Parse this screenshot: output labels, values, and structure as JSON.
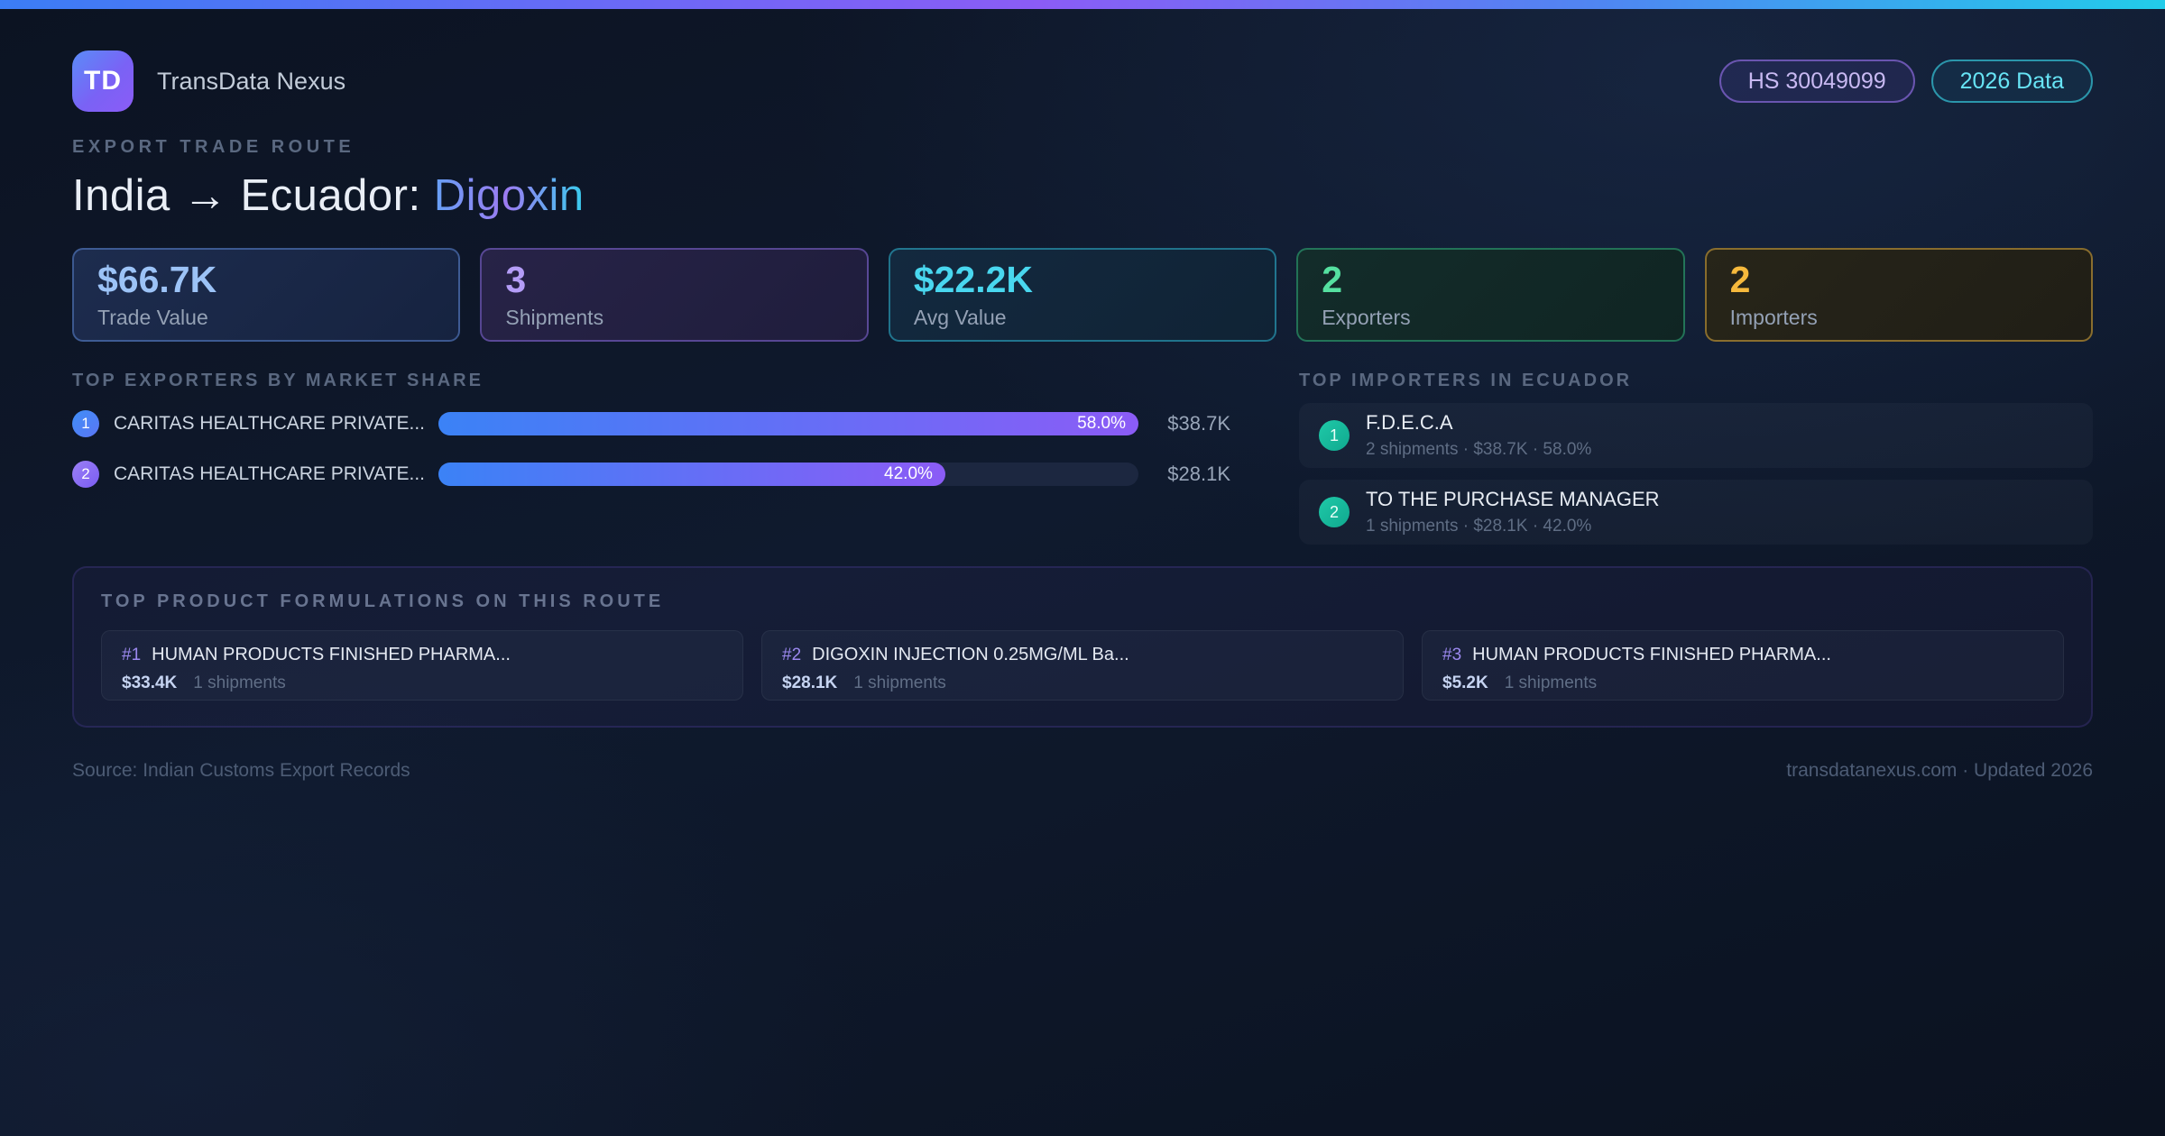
{
  "header": {
    "logo_text": "TD",
    "app_name": "TransData Nexus",
    "hs_badge": "HS 30049099",
    "year_badge": "2026 Data"
  },
  "hero": {
    "eyebrow": "EXPORT TRADE ROUTE",
    "title_route": "India → Ecuador: ",
    "title_product": "Digoxin"
  },
  "stats": [
    {
      "value": "$66.7K",
      "label": "Trade Value"
    },
    {
      "value": "3",
      "label": "Shipments"
    },
    {
      "value": "$22.2K",
      "label": "Avg Value"
    },
    {
      "value": "2",
      "label": "Exporters"
    },
    {
      "value": "2",
      "label": "Importers"
    }
  ],
  "exporters": {
    "heading": "TOP EXPORTERS BY MARKET SHARE",
    "rows": [
      {
        "rank": "1",
        "name": "CARITAS HEALTHCARE PRIVATE...",
        "share_pct": 58.0,
        "share_label": "58.0%",
        "value": "$38.7K"
      },
      {
        "rank": "2",
        "name": "CARITAS HEALTHCARE PRIVATE...",
        "share_pct": 42.0,
        "share_label": "42.0%",
        "value": "$28.1K"
      }
    ]
  },
  "importers": {
    "heading": "TOP IMPORTERS IN ECUADOR",
    "rows": [
      {
        "rank": "1",
        "name": "F.D.E.C.A",
        "meta": "2 shipments · $38.7K · 58.0%"
      },
      {
        "rank": "2",
        "name": "TO THE PURCHASE MANAGER",
        "meta": "1 shipments · $28.1K · 42.0%"
      }
    ]
  },
  "formulations": {
    "heading": "TOP PRODUCT FORMULATIONS ON THIS ROUTE",
    "cards": [
      {
        "rank": "#1",
        "name": "HUMAN PRODUCTS FINISHED PHARMA...",
        "value": "$33.4K",
        "shipments": "1 shipments"
      },
      {
        "rank": "#2",
        "name": "DIGOXIN INJECTION 0.25MG/ML Ba...",
        "value": "$28.1K",
        "shipments": "1 shipments"
      },
      {
        "rank": "#3",
        "name": "HUMAN PRODUCTS FINISHED PHARMA...",
        "value": "$5.2K",
        "shipments": "1 shipments"
      }
    ]
  },
  "footer": {
    "source": "Source: Indian Customs Export Records",
    "site": "transdatanexus.com · Updated 2026"
  },
  "chart_data": {
    "type": "bar",
    "orientation": "horizontal",
    "title": "TOP EXPORTERS BY MARKET SHARE",
    "categories": [
      "CARITAS HEALTHCARE PRIVATE...",
      "CARITAS HEALTHCARE PRIVATE..."
    ],
    "series": [
      {
        "name": "Market share (%)",
        "values": [
          58.0,
          42.0
        ]
      },
      {
        "name": "Trade value (USD)",
        "values": [
          38700,
          28100
        ]
      }
    ],
    "legend": false,
    "grid": false
  },
  "colors": {
    "accent_blue": "#3b82f6",
    "accent_purple": "#8b5cf6",
    "accent_cyan": "#22d3ee",
    "accent_green": "#34d399",
    "accent_amber": "#f6b93c",
    "background": "#0d1628"
  }
}
